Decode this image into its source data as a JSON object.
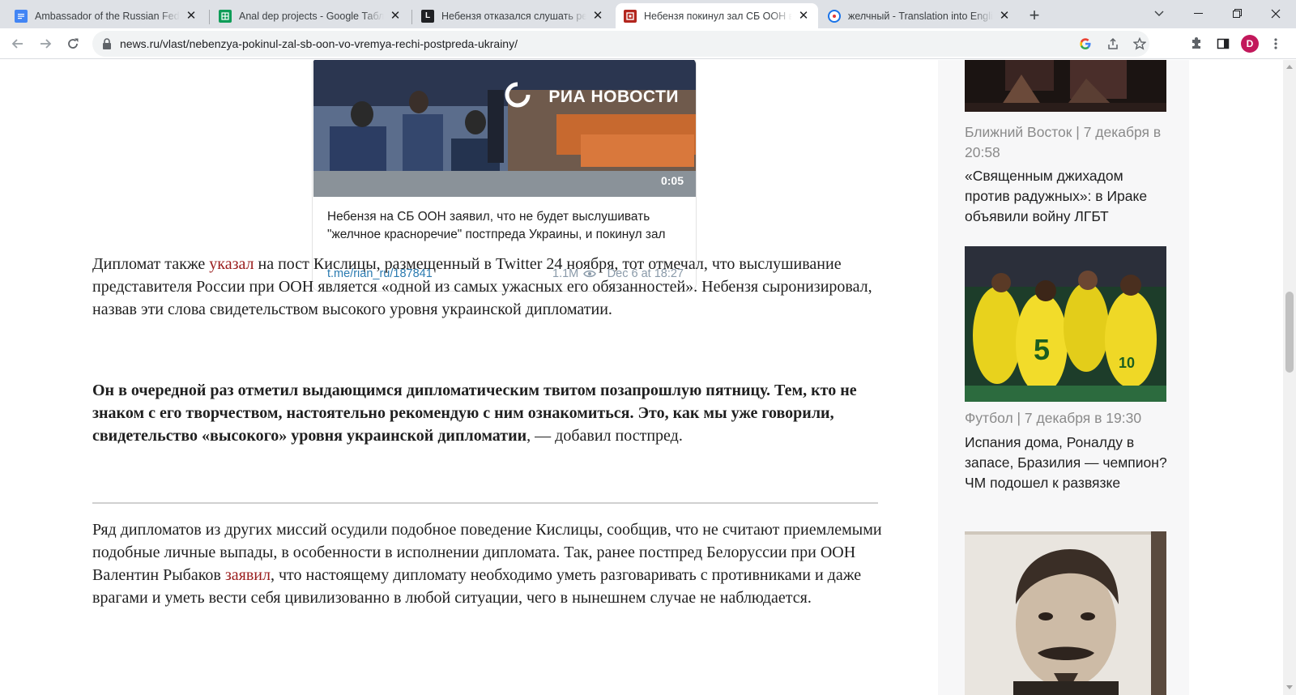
{
  "browser": {
    "tabs": [
      {
        "title": "Ambassador of the Russian Federation",
        "icon": "docs-icon",
        "color": "#4285f4",
        "active": false
      },
      {
        "title": "Anal dep projects - Google Таблицы",
        "icon": "sheets-icon",
        "color": "#0f9d58",
        "active": false
      },
      {
        "title": "Небензя отказался слушать речь",
        "icon": "l-site-icon",
        "color": "#202124",
        "active": false
      },
      {
        "title": "Небензя покинул зал СБ ООН во время речи",
        "icon": "news-site-icon",
        "color": "#b3261e",
        "active": true
      },
      {
        "title": "желчный - Translation into English",
        "icon": "reverso-icon",
        "color": "#1a73e8",
        "active": false
      }
    ],
    "url": "news.ru/vlast/nebenzya-pokinul-zal-sb-oon-vo-vremya-rechi-postpreda-ukrainy/",
    "profile_initial": "D",
    "profile_color": "#c2185b"
  },
  "telegram_embed": {
    "watermark": "РИА НОВОСТИ",
    "duration": "0:05",
    "caption": "Небензя на СБ ООН заявил, что не будет выслушивать \"желчное красноречие\" постпреда Украины, и покинул зал",
    "link": "t.me/rian_ru/187841",
    "views": "1.1M",
    "date": "Dec 6 at 18:27"
  },
  "article": {
    "p1_before": "Дипломат также ",
    "p1_link": "указал",
    "p1_after": " на пост Кислицы, размещенный в Twitter 24 ноября, тот отмечал, что выслушивание представителя России при ООН является «одной из самых ужасных его обязанностей». Небензя сыронизировал, назвав эти слова свидетельством высокого уровня украинской дипломатии.",
    "quote_bold": "Он в очередной раз отметил выдающимся дипломатическим твитом позапрошлую пятницу. Тем, кто не знаком с его творчеством, настоятельно рекомендую с ним ознакомиться. Это, как мы уже говорили, свидетельство «высокого» уровня украинской дипломатии",
    "quote_tail": ", — добавил постпред.",
    "p2_before": "Ряд дипломатов из других миссий осудили подобное поведение Кислицы, сообщив, что не считают приемлемыми подобные личные выпады, в особенности в исполнении дипломата. Так, ранее постпред Белоруссии при ООН Валентин Рыбаков ",
    "p2_link": "заявил",
    "p2_after": ", что настоящему дипломату необходимо уметь разговаривать с противниками и даже врагами и уметь вести себя цивилизованно в любой ситуации, чего в нынешнем случае не наблюдается."
  },
  "sidebar": {
    "items": [
      {
        "meta": "Ближний Восток | 7 декабря в 20:58",
        "title": "«Священным джихадом против радужных»: в Ираке объявили войну ЛГБТ"
      },
      {
        "meta": "Футбол | 7 декабря в 19:30",
        "title": "Испания дома, Роналду в запасе, Бразилия — чемпион? ЧМ подошел к развязке"
      }
    ]
  }
}
